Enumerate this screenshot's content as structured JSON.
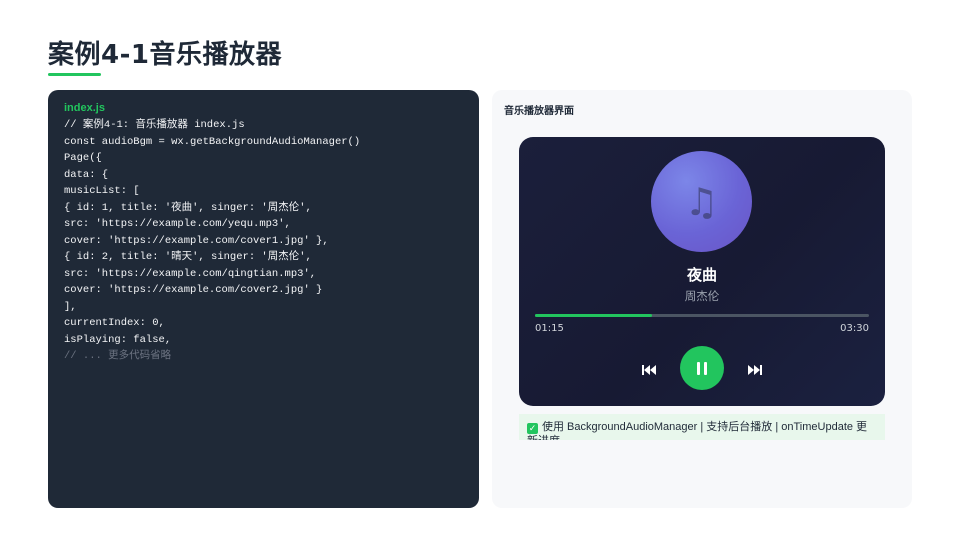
{
  "page": {
    "title": "案例4-1音乐播放器"
  },
  "code": {
    "filename": "index.js",
    "lines": [
      "// 案例4-1: 音乐播放器 index.js",
      "const audioBgm = wx.getBackgroundAudioManager()",
      "Page({",
      "data: {",
      "musicList: [",
      "{ id: 1, title: '夜曲', singer: '周杰伦',",
      "src: 'https://example.com/yequ.mp3',",
      "cover: 'https://example.com/cover1.jpg' },",
      "{ id: 2, title: '晴天', singer: '周杰伦',",
      "src: 'https://example.com/qingtian.mp3',",
      "cover: 'https://example.com/cover2.jpg' }",
      "],",
      "currentIndex: 0,",
      "isPlaying: false,"
    ],
    "faded_line": "// ... 更多代码省略"
  },
  "preview": {
    "title": "音乐播放器界面",
    "player": {
      "cover_icon": "music-note-icon",
      "song_title": "夜曲",
      "singer": "周杰伦",
      "progress": 0.35,
      "time_current": "01:15",
      "time_total": "03:30",
      "controls": [
        "previous-track-icon",
        "pause-icon",
        "next-track-icon"
      ]
    },
    "banner": {
      "icon": "check-icon",
      "text": "使用 BackgroundAudioManager | 支持后台播放 | onTimeUpdate 更新进度"
    }
  },
  "colors": {
    "accent": "#22c55e",
    "code_bg": "#1f2937",
    "player_bg": "#1b1f3b"
  }
}
